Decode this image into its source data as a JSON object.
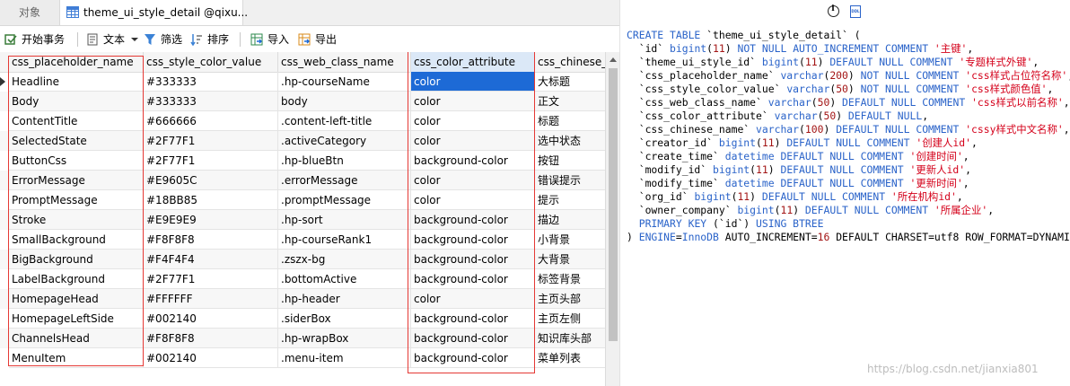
{
  "tabs": [
    {
      "label": "对象"
    },
    {
      "label": "theme_ui_style_detail @qixu..."
    }
  ],
  "toolbar": {
    "begin_tx": "开始事务",
    "text": "文本",
    "filter": "筛选",
    "sort": "排序",
    "import": "导入",
    "export": "导出"
  },
  "grid": {
    "columns": [
      "css_placeholder_name",
      "css_style_color_value",
      "css_web_class_name",
      "css_color_attribute",
      "css_chinese_name"
    ],
    "rows": [
      [
        "Headline",
        "#333333",
        ".hp-courseName",
        "color",
        "大标题"
      ],
      [
        "Body",
        "#333333",
        "body",
        "color",
        "正文"
      ],
      [
        "ContentTitle",
        "#666666",
        ".content-left-title",
        "color",
        "标题"
      ],
      [
        "SelectedState",
        "#2F77F1",
        ".activeCategory",
        "color",
        "选中状态"
      ],
      [
        "ButtonCss",
        "#2F77F1",
        ".hp-blueBtn",
        "background-color",
        "按钮"
      ],
      [
        "ErrorMessage",
        "#E9605C",
        ".errorMessage",
        "color",
        "错误提示"
      ],
      [
        "PromptMessage",
        "#18BB85",
        ".promptMessage",
        "color",
        "提示"
      ],
      [
        "Stroke",
        "#E9E9E9",
        ".hp-sort",
        "background-color",
        "描边"
      ],
      [
        "SmallBackground",
        "#F8F8F8",
        ".hp-courseRank1",
        "background-color",
        "小背景"
      ],
      [
        "BigBackground",
        "#F4F4F4",
        ".zszx-bg",
        "background-color",
        "大背景"
      ],
      [
        "LabelBackground",
        "#2F77F1",
        ".bottomActive",
        "background-color",
        "标签背景"
      ],
      [
        "HomepageHead",
        "#FFFFFF",
        ".hp-header",
        "color",
        "主页头部"
      ],
      [
        "HomepageLeftSide",
        "#002140",
        ".siderBox",
        "background-color",
        "主页左侧"
      ],
      [
        "ChannelsHead",
        "#F8F8F8",
        ".hp-wrapBox",
        "background-color",
        "知识库头部"
      ],
      [
        "MenuItem",
        "#002140",
        ".menu-item",
        "background-color",
        "菜单列表"
      ]
    ]
  },
  "ddl": {
    "watermark": "https://blog.csdn.net/jianxia801"
  },
  "colors": {
    "keyword": "#2a63c9",
    "string": "#d4001a",
    "selection": "#1d6ad6",
    "highlight_box": "#e53935"
  }
}
